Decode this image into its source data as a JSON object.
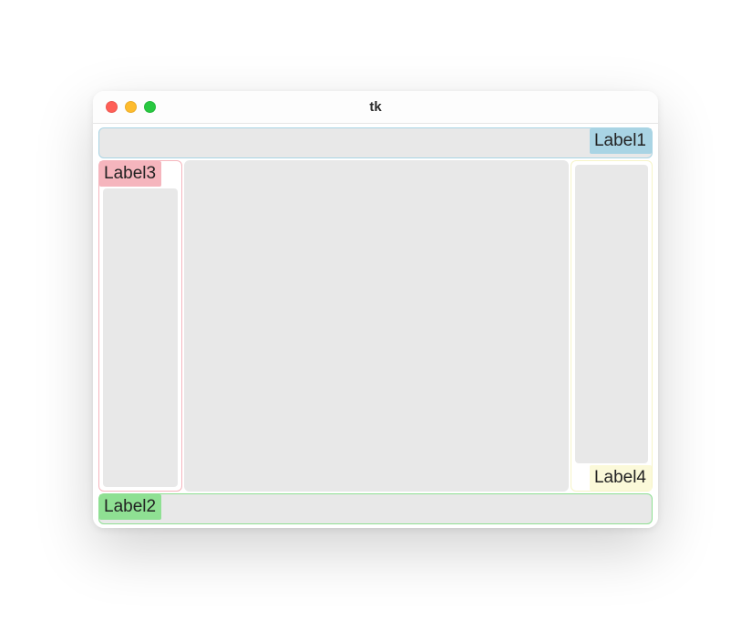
{
  "window": {
    "title": "tk"
  },
  "labels": {
    "label1": "Label1",
    "label2": "Label2",
    "label3": "Label3",
    "label4": "Label4"
  },
  "colors": {
    "label1_bg": "#a9d4e4",
    "label2_bg": "#8fe093",
    "label3_bg": "#f5b5bd",
    "label4_bg": "#fbf9d9",
    "frame_fill": "#e8e8e8"
  }
}
